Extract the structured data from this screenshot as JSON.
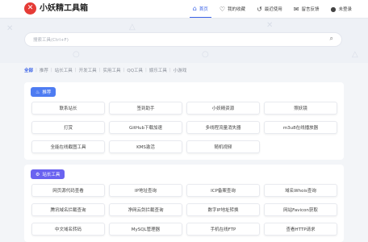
{
  "app": {
    "title": "小妖精工具箱",
    "logo_glyph": "✕"
  },
  "nav": [
    {
      "label": "首页",
      "icon": "⌂",
      "icon_name": "home-icon",
      "active": true
    },
    {
      "label": "我的收藏",
      "icon": "♡",
      "icon_name": "heart-icon",
      "active": false
    },
    {
      "label": "最近使用",
      "icon": "↺",
      "icon_name": "history-icon",
      "active": false
    },
    {
      "label": "留言反馈",
      "icon": "✉",
      "icon_name": "message-icon",
      "active": false
    },
    {
      "label": "未登录",
      "icon": "●",
      "icon_name": "user-icon",
      "active": false
    }
  ],
  "search": {
    "placeholder": "搜索工具(Ctrl+F)",
    "icon": "search-icon"
  },
  "categories": [
    "全部",
    "推荐",
    "站长工具",
    "开发工具",
    "实用工具",
    "QQ工具",
    "娱乐工具",
    "小游戏"
  ],
  "active_category": "全部",
  "sections": [
    {
      "title": "推荐",
      "icon": "flame-icon",
      "color": "#4e7cf2",
      "tools": [
        "联系站长",
        "签到助手",
        "小妖精资源",
        "照妖镜",
        "打赏",
        "GitHub下载加速",
        "多线程流量消失器",
        "m3u8在线播放器",
        "全能在线截图工具",
        "KMS激活",
        "随机视频"
      ]
    },
    {
      "title": "站长工具",
      "icon": "gear-icon",
      "color": "#6a63f0",
      "tools": [
        "网页源代码查看",
        "IP地址查询",
        "ICP备案查询",
        "域名Whois查询",
        "腾讯域名拦截查询",
        "净网云剑拦截查询",
        "数字IP地址转换",
        "网站Favicon获取",
        "中文域名转码",
        "MySQL管理器",
        "手机在线FTP",
        "查看HTTP请求"
      ]
    }
  ]
}
